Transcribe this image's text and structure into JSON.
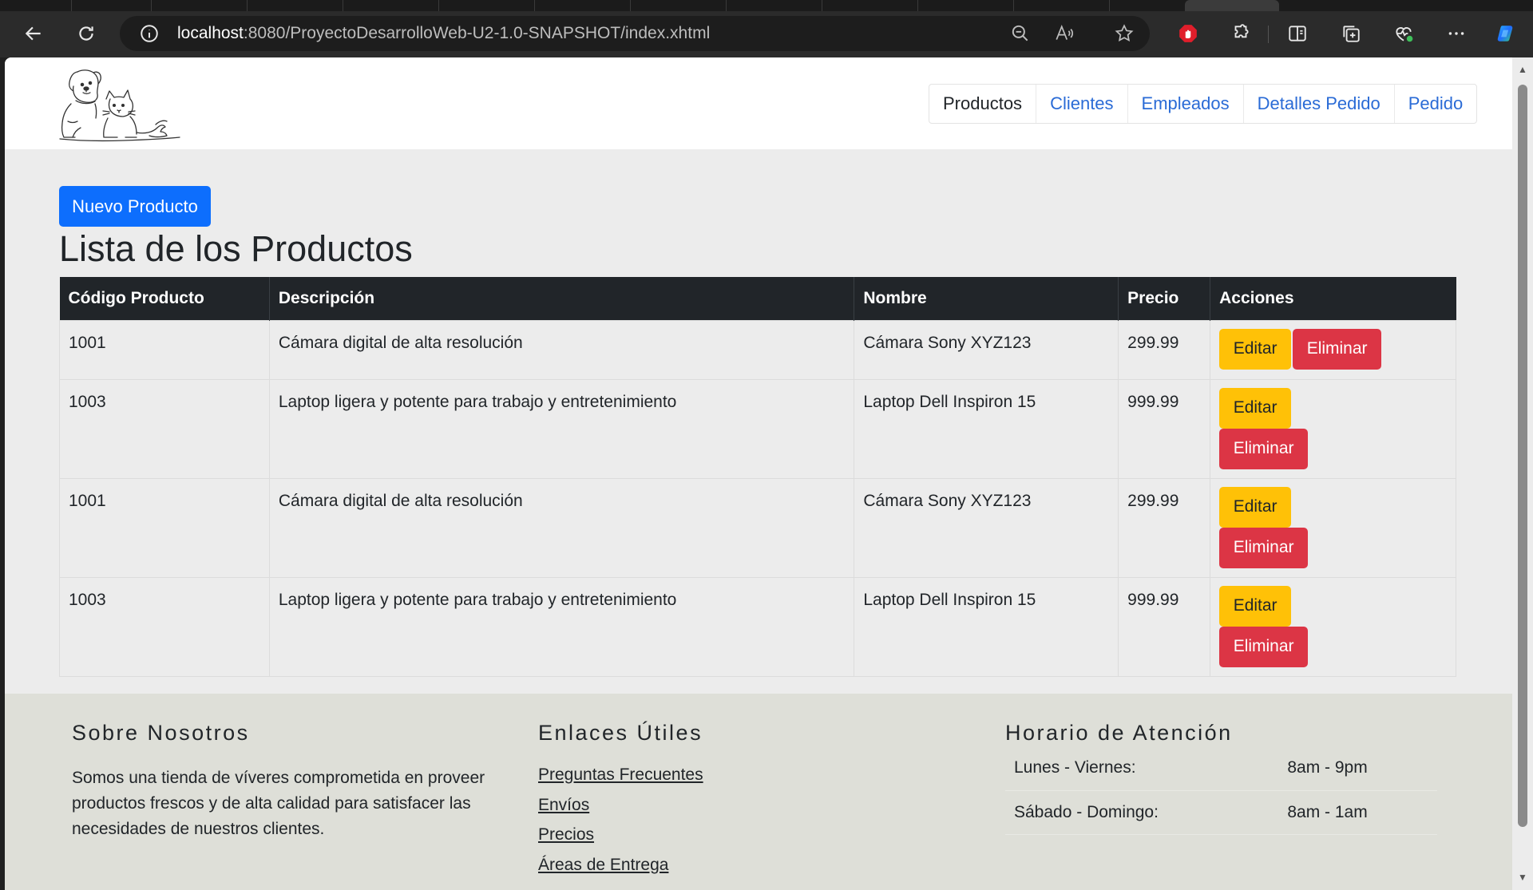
{
  "browser": {
    "url_host": "localhost",
    "url_rest": ":8080/ProyectoDesarrolloWeb-U2-1.0-SNAPSHOT/index.xhtml"
  },
  "navbar": {
    "items": [
      {
        "label": "Productos",
        "active": true
      },
      {
        "label": "Clientes",
        "active": false
      },
      {
        "label": "Empleados",
        "active": false
      },
      {
        "label": "Detalles Pedido",
        "active": false
      },
      {
        "label": "Pedido",
        "active": false
      }
    ]
  },
  "main": {
    "new_button": "Nuevo Producto",
    "title": "Lista de los Productos",
    "table": {
      "headers": [
        "Código Producto",
        "Descripción",
        "Nombre",
        "Precio",
        "Acciones"
      ],
      "edit_label": "Editar",
      "delete_label": "Eliminar",
      "rows": [
        {
          "codigo": "1001",
          "descripcion": "Cámara digital de alta resolución",
          "nombre": "Cámara Sony XYZ123",
          "precio": "299.99"
        },
        {
          "codigo": "1003",
          "descripcion": "Laptop ligera y potente para trabajo y entretenimiento",
          "nombre": "Laptop Dell Inspiron 15",
          "precio": "999.99"
        },
        {
          "codigo": "1001",
          "descripcion": "Cámara digital de alta resolución",
          "nombre": "Cámara Sony XYZ123",
          "precio": "299.99"
        },
        {
          "codigo": "1003",
          "descripcion": "Laptop ligera y potente para trabajo y entretenimiento",
          "nombre": "Laptop Dell Inspiron 15",
          "precio": "999.99"
        }
      ]
    }
  },
  "footer": {
    "about": {
      "title": "Sobre Nosotros",
      "text": "Somos una tienda de víveres comprometida en proveer productos frescos y de alta calidad para satisfacer las necesidades de nuestros clientes."
    },
    "links": {
      "title": "Enlaces Útiles",
      "items": [
        "Preguntas Frecuentes",
        "Envíos",
        "Precios",
        "Áreas de Entrega"
      ]
    },
    "hours": {
      "title": "Horario de Atención",
      "rows": [
        {
          "days": "Lunes - Viernes:",
          "time": "8am - 9pm"
        },
        {
          "days": "Sábado - Domingo:",
          "time": "8am - 1am"
        }
      ]
    }
  },
  "colors": {
    "primary": "#0d6efd",
    "warning": "#ffc107",
    "danger": "#dc3545",
    "table_header": "#212529",
    "footer_bg": "#dedfd8"
  },
  "icons": [
    "back-icon",
    "refresh-icon",
    "info-icon",
    "zoom-out-icon",
    "read-aloud-icon",
    "favorite-star-icon",
    "adblock-icon",
    "extensions-icon",
    "split-screen-icon",
    "collections-icon",
    "browser-essentials-icon",
    "more-icon",
    "copilot-icon"
  ]
}
